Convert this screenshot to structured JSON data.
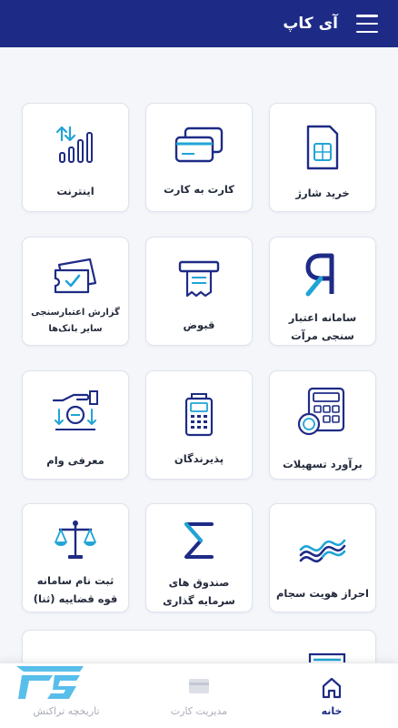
{
  "app": {
    "title": "آی کاپ"
  },
  "cards": [
    {
      "label": "خرید شارژ",
      "icon": "sim-card-icon"
    },
    {
      "label": "کارت به کارت",
      "icon": "cards-icon"
    },
    {
      "label": "اینترنت",
      "icon": "signal-bars-icon"
    },
    {
      "label": "سامانه اعتبار سنجی مرآت",
      "icon": "merat-logo-icon"
    },
    {
      "label": "قبوض",
      "icon": "bill-icon"
    },
    {
      "label": "گزارش اعتبارسنجی سایر بانک‌ها",
      "icon": "ticket-check-icon"
    },
    {
      "label": "برآورد تسهیلات",
      "icon": "calculator-icon"
    },
    {
      "label": "پذیرندگان",
      "icon": "pos-terminal-icon"
    },
    {
      "label": "معرفی وام",
      "icon": "loan-hand-icon"
    },
    {
      "label": "احراز هویت سجام",
      "icon": "sejam-logo-icon"
    },
    {
      "label": "صندوق های سرمایه گذاری",
      "icon": "sigma-icon"
    },
    {
      "label": "ثبت نام سامانه قوه قضاییه (ثنا)",
      "icon": "justice-scale-icon"
    }
  ],
  "partial_card": {
    "icon": "ata-logo-icon"
  },
  "bottom_nav": [
    {
      "label": "خانه",
      "icon": "home-icon",
      "active": true
    },
    {
      "label": "مدیریت کارت",
      "icon": "card-icon",
      "active": false
    },
    {
      "label": "تاریخچه تراکنش",
      "icon": "history-icon",
      "active": false
    }
  ],
  "colors": {
    "primary": "#1e2b86",
    "accent": "#20a4d6",
    "background": "#f4f6fa"
  }
}
